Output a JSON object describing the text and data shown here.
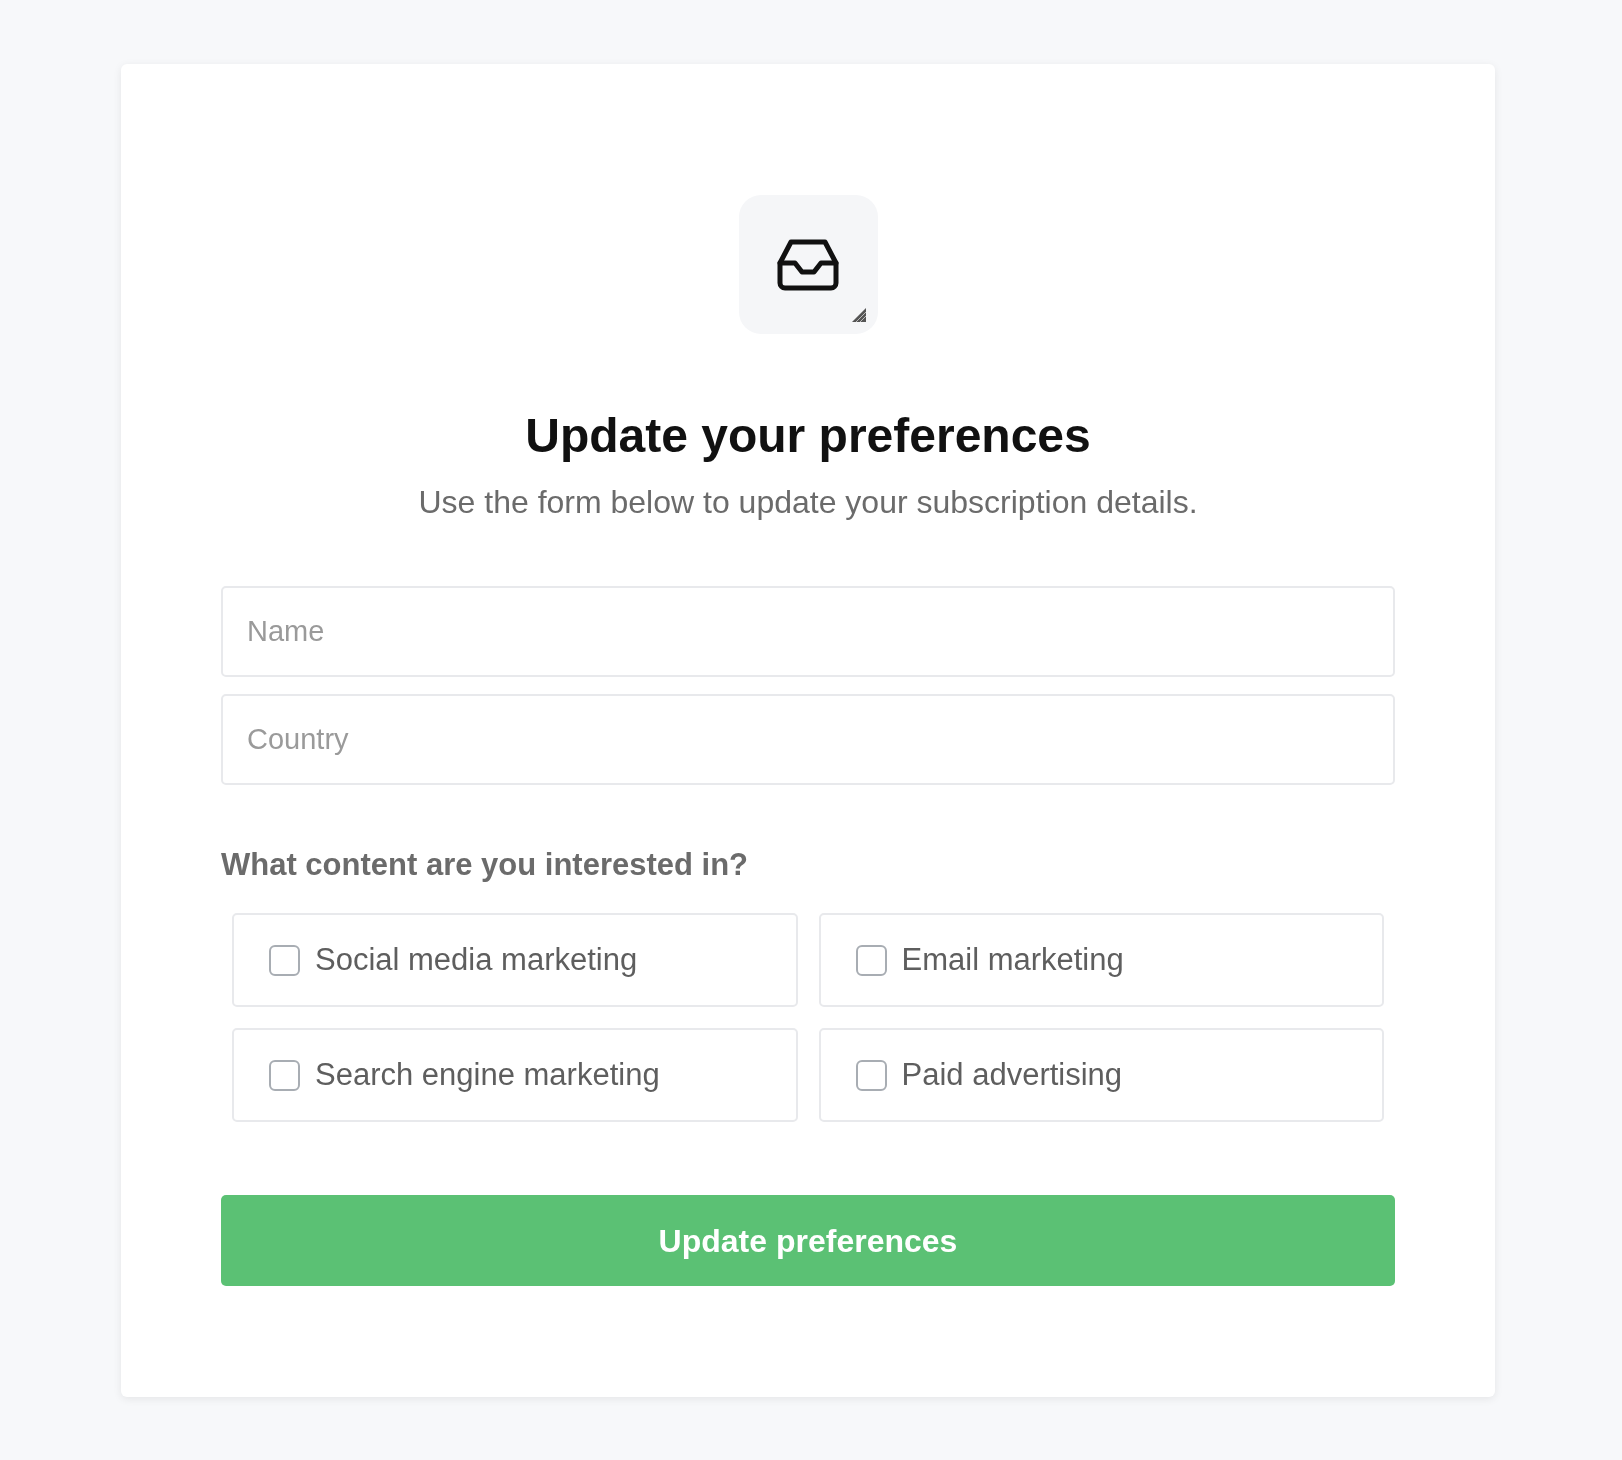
{
  "header": {
    "title": "Update your preferences",
    "subtitle": "Use the form below to update your subscription details."
  },
  "fields": [
    {
      "placeholder": "Name"
    },
    {
      "placeholder": "Country"
    }
  ],
  "interests": {
    "question": "What content are you interested in?",
    "options": [
      {
        "label": "Social media marketing",
        "checked": false
      },
      {
        "label": "Email marketing",
        "checked": false
      },
      {
        "label": "Search engine marketing",
        "checked": false
      },
      {
        "label": "Paid advertising",
        "checked": false
      }
    ]
  },
  "submit_button": {
    "label": "Update preferences"
  }
}
